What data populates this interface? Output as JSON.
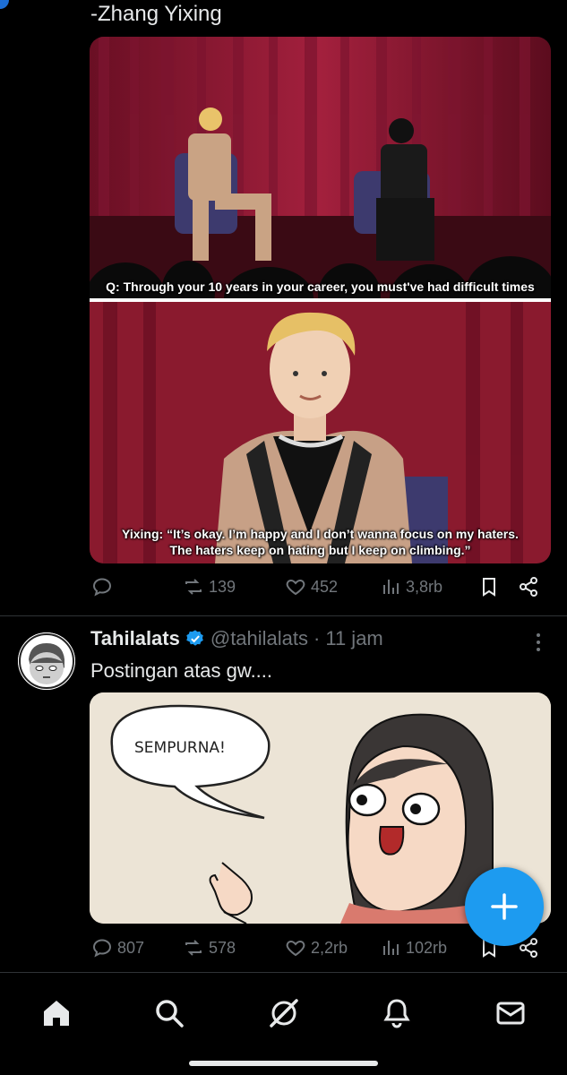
{
  "quoted_post": {
    "text_tail": "-Zhang Yixing",
    "caption_top": "Q: Through your 10 years in your career, you must've had difficult times",
    "caption_bottom_line1": "Yixing: “It’s okay. I’m happy and I don’t wanna focus on my haters.",
    "caption_bottom_line2": "The haters keep on hating but I keep on climbing.”",
    "actions": {
      "reply_icon": "reply-icon",
      "retweet_count": "139",
      "like_count": "452",
      "views_count": "3,8rb"
    }
  },
  "post": {
    "name": "Tahilalats",
    "handle": "@tahilalats",
    "dot": "·",
    "time": "11 jam",
    "text": "Postingan atas gw....",
    "comic_bubble_text": "SEMPURNA!",
    "actions": {
      "reply_count": "807",
      "retweet_count": "578",
      "like_count": "2,2rb",
      "views_count": "102rb"
    }
  },
  "colors": {
    "accent": "#1d9bf0",
    "muted": "#71767b",
    "divider": "#2f3336"
  },
  "nav": {
    "items": [
      "home-icon",
      "search-icon",
      "grok-icon",
      "notifications-icon",
      "messages-icon"
    ]
  }
}
